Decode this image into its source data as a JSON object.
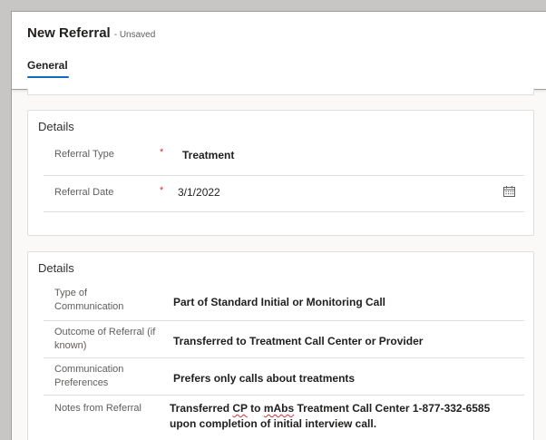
{
  "header": {
    "title": "New Referral",
    "status": "- Unsaved"
  },
  "tabs": [
    {
      "label": "General",
      "active": true
    }
  ],
  "section1": {
    "title": "Details",
    "fields": [
      {
        "label": "Referral Type",
        "required_mark": "*",
        "value": "Treatment"
      },
      {
        "label": "Referral Date",
        "required_mark": "*",
        "value": "3/1/2022",
        "icon": "calendar-icon"
      }
    ]
  },
  "section2": {
    "title": "Details",
    "fields": [
      {
        "label_line1": "Type of",
        "label_line2": "Communication",
        "value": "Part of Standard Initial or Monitoring Call"
      },
      {
        "label_line1": "Outcome of Referral (if",
        "label_line2": "known)",
        "value": "Transferred to Treatment Call Center or Provider"
      },
      {
        "label_line1": "Communication",
        "label_line2": "Preferences",
        "value": "Prefers only calls about treatments"
      },
      {
        "label": "Notes from Referral",
        "value_line1_a": "Transferred ",
        "value_line1_b": "CP",
        "value_line1_c": " to ",
        "value_line1_d": "mAbs",
        "value_line1_e": " Treatment Call Center 1-877-332-6585",
        "value_line2": "upon completion of initial interview call."
      }
    ]
  },
  "colors": {
    "accent": "#0f6cbd",
    "required": "#d13438"
  }
}
